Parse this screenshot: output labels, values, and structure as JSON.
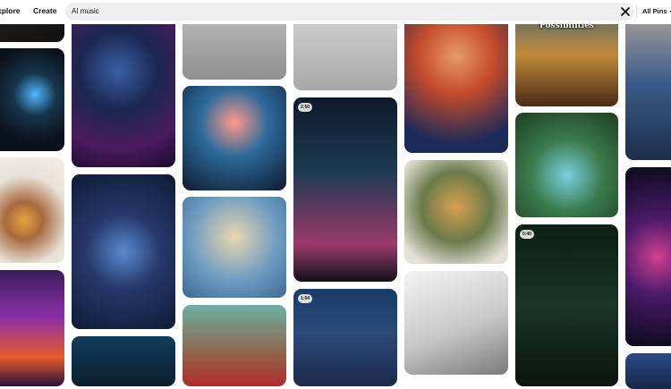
{
  "nav": {
    "explore_label": "xplore",
    "create_label": "Create"
  },
  "search": {
    "query": "AI music"
  },
  "filter": {
    "label": "All Pins"
  },
  "icons": {
    "clear": "close-icon",
    "filter_chevron": "chevron-down-icon"
  },
  "pins": [
    {
      "badge": ""
    },
    {
      "badge": ""
    },
    {
      "badge": ""
    },
    {
      "badge": ""
    },
    {
      "badge": ""
    },
    {
      "badge": ""
    },
    {
      "badge": ""
    },
    {
      "badge": ""
    },
    {
      "badge": ""
    },
    {
      "badge": ""
    },
    {
      "badge": ""
    },
    {
      "badge": ""
    },
    {
      "badge": "2:50"
    },
    {
      "badge": "1:04"
    },
    {
      "badge": ""
    },
    {
      "badge": ""
    },
    {
      "badge": ""
    },
    {
      "badge": ""
    },
    {
      "badge": ""
    },
    {
      "badge": "0:40"
    },
    {
      "badge": ""
    },
    {
      "badge": ""
    },
    {
      "badge": ""
    }
  ],
  "overlay": {
    "caption": "Music with Infinite Possibilities"
  }
}
